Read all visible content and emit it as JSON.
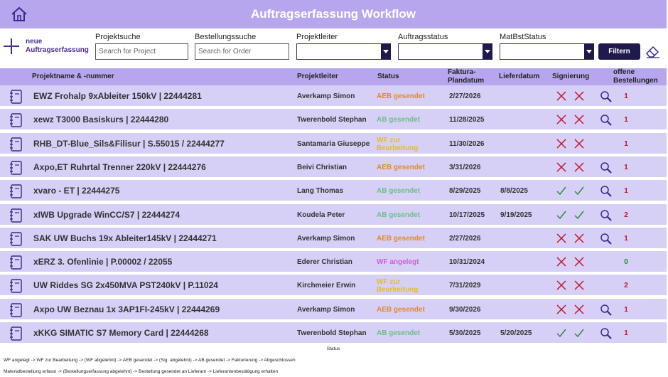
{
  "header": {
    "title": "Auftragserfassung Workflow"
  },
  "toolbar": {
    "new_label": "neue Auftragserfassung",
    "filter_button": "Filtern"
  },
  "filters": {
    "projektsuche": {
      "label": "Projektsuche",
      "placeholder": "Search for Project",
      "value": ""
    },
    "bestellungssuche": {
      "label": "Bestellungssuche",
      "placeholder": "Search for Order",
      "value": ""
    },
    "projektleiter": {
      "label": "Projektleiter",
      "value": ""
    },
    "auftragsstatus": {
      "label": "Auftragsstatus",
      "value": ""
    },
    "matbststatus": {
      "label": "MatBstStatus",
      "value": ""
    }
  },
  "columns": {
    "name": "Projektname & -nummer",
    "leader": "Projektleiter",
    "status": "Status",
    "faktura": "Faktura-Plandatum",
    "liefer": "Lieferdatum",
    "signierung": "Signierung",
    "offen": "offene Bestellungen"
  },
  "colors": {
    "AEB gesendet": "#e38a2a",
    "AB gesendet": "#6fbf8a",
    "WF zur Bearbeitung": "#e3c11d",
    "WF angelegt": "#cf5fd8",
    "count_red": "#c3152b",
    "count_green": "#1c8a2e"
  },
  "rows": [
    {
      "name": "EWZ Frohalp 9xAbleiter 150kV | 22444281",
      "leader": "Averkamp Simon",
      "status": "AEB gesendet",
      "faktura": "2/27/2026",
      "liefer": "",
      "sig": [
        "cross",
        "cross"
      ],
      "search": true,
      "count": "1"
    },
    {
      "name": "xewz T3000 Basiskurs | 22444280",
      "leader": "Twerenbold Stephan",
      "status": "AB gesendet",
      "faktura": "11/28/2025",
      "liefer": "",
      "sig": [
        "cross",
        "cross"
      ],
      "search": true,
      "count": "1"
    },
    {
      "name": "RHB_DT-Blue_Sils&Filisur | S.55015 / 22444277",
      "leader": "Santamaria Giuseppe",
      "status": "WF zur Bearbeitung",
      "faktura": "11/30/2026",
      "liefer": "",
      "sig": [
        "cross",
        "cross"
      ],
      "search": false,
      "count": "1"
    },
    {
      "name": "Axpo,ET Ruhrtal Trenner 220kV | 22444276",
      "leader": "Beivi Christian",
      "status": "AEB gesendet",
      "faktura": "3/31/2026",
      "liefer": "",
      "sig": [
        "cross",
        "cross"
      ],
      "search": true,
      "count": "1"
    },
    {
      "name": "xvaro - ET | 22444275",
      "leader": "Lang Thomas",
      "status": "AB gesendet",
      "faktura": "8/29/2025",
      "liefer": "8/8/2025",
      "sig": [
        "check",
        "check"
      ],
      "search": true,
      "count": "1"
    },
    {
      "name": "xIWB Upgrade WinCC/S7 | 22444274",
      "leader": "Koudela Peter",
      "status": "AB gesendet",
      "faktura": "10/17/2025",
      "liefer": "9/19/2025",
      "sig": [
        "check",
        "check"
      ],
      "search": true,
      "count": "2"
    },
    {
      "name": "SAK UW Buchs 19x Ableiter145kV | 22444271",
      "leader": "Averkamp Simon",
      "status": "AEB gesendet",
      "faktura": "2/27/2026",
      "liefer": "",
      "sig": [
        "cross",
        "cross"
      ],
      "search": true,
      "count": "1"
    },
    {
      "name": "xERZ 3. Ofenlinie | P.00002 / 22055",
      "leader": "Ederer Christian",
      "status": "WF angelegt",
      "faktura": "10/31/2024",
      "liefer": "",
      "sig": [
        "cross",
        "cross"
      ],
      "search": false,
      "count": "0"
    },
    {
      "name": "UW Riddes SG 2x450MVA PST240kV | P.11024",
      "leader": "Kirchmeier Erwin",
      "status": "WF zur Bearbeitung",
      "faktura": "7/31/2029",
      "liefer": "",
      "sig": [
        "cross",
        "cross"
      ],
      "search": false,
      "count": "2"
    },
    {
      "name": "Axpo UW Beznau 1x 3AP1FI-245kV | 22444269",
      "leader": "Averkamp Simon",
      "status": "AEB gesendet",
      "faktura": "9/30/2026",
      "liefer": "",
      "sig": [
        "cross",
        "cross"
      ],
      "search": true,
      "count": "1"
    },
    {
      "name": "xKKG SIMATIC S7 Memory Card | 22444268",
      "leader": "Twerenbold Stephan",
      "status": "AB gesendet",
      "faktura": "5/30/2025",
      "liefer": "5/20/2025",
      "sig": [
        "check",
        "check"
      ],
      "search": true,
      "count": "1"
    }
  ],
  "footer": {
    "status_label": "Status",
    "legend_workflow": "WF angelegt -> WF zur Bearbeitung -> (WF abgelehnt) -> AEB gesendet -> (Sig. abgelehnt) -> AB gesendet -> Fakturierung -> Abgeschlossen",
    "legend_material": "Materialbestellung erfasst -> (Bestellungserfassung abgelehnt) -> Bestellung gesendet an Lieferant -> Lieferantenbestätigung erhalten"
  }
}
